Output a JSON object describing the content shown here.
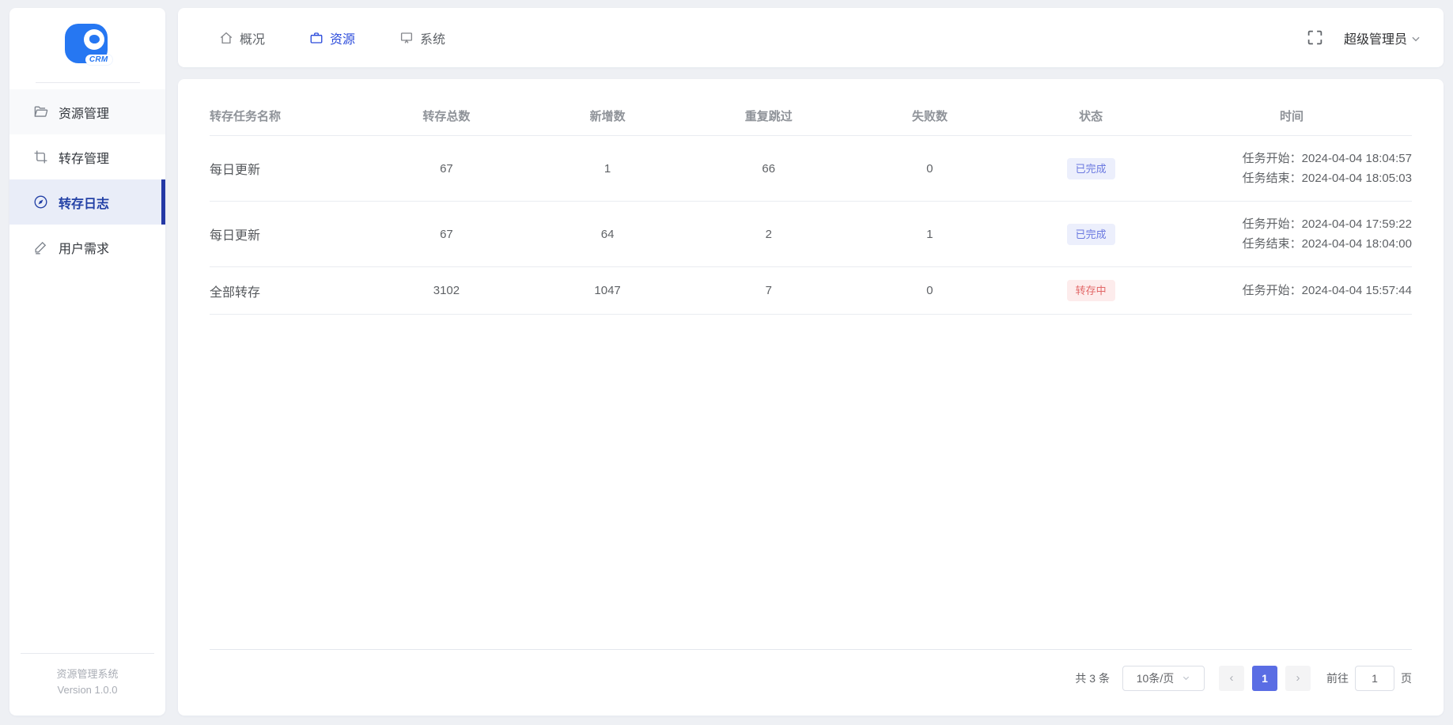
{
  "app": {
    "logo_text": "CRM",
    "footer_title": "资源管理系统",
    "footer_version": "Version 1.0.0"
  },
  "sidebar": {
    "items": [
      {
        "id": "resource-management",
        "label": "资源管理",
        "icon": "folder-icon",
        "active": false,
        "state": "hover"
      },
      {
        "id": "transfer-management",
        "label": "转存管理",
        "icon": "crop-icon",
        "active": false,
        "state": ""
      },
      {
        "id": "transfer-log",
        "label": "转存日志",
        "icon": "compass-icon",
        "active": true,
        "state": ""
      },
      {
        "id": "user-requests",
        "label": "用户需求",
        "icon": "edit-icon",
        "active": false,
        "state": ""
      }
    ]
  },
  "header": {
    "tabs": [
      {
        "id": "overview",
        "label": "概况",
        "icon": "home-icon",
        "active": false
      },
      {
        "id": "resources",
        "label": "资源",
        "icon": "briefcase-icon",
        "active": true
      },
      {
        "id": "system",
        "label": "系统",
        "icon": "monitor-icon",
        "active": false
      }
    ],
    "user_menu": "超级管理员"
  },
  "table": {
    "columns": [
      "转存任务名称",
      "转存总数",
      "新增数",
      "重复跳过",
      "失败数",
      "状态",
      "时间"
    ],
    "rows": [
      {
        "name": "每日更新",
        "total": "67",
        "added": "1",
        "skipped": "66",
        "failed": "0",
        "status": {
          "label": "已完成",
          "type": "done"
        },
        "times": [
          {
            "label": "任务开始：",
            "value": "2024-04-04 18:04:57"
          },
          {
            "label": "任务结束：",
            "value": "2024-04-04 18:05:03"
          }
        ]
      },
      {
        "name": "每日更新",
        "total": "67",
        "added": "64",
        "skipped": "2",
        "failed": "1",
        "status": {
          "label": "已完成",
          "type": "done"
        },
        "times": [
          {
            "label": "任务开始：",
            "value": "2024-04-04 17:59:22"
          },
          {
            "label": "任务结束：",
            "value": "2024-04-04 18:04:00"
          }
        ]
      },
      {
        "name": "全部转存",
        "total": "3102",
        "added": "1047",
        "skipped": "7",
        "failed": "0",
        "status": {
          "label": "转存中",
          "type": "running"
        },
        "times": [
          {
            "label": "任务开始：",
            "value": "2024-04-04 15:57:44"
          }
        ]
      }
    ]
  },
  "pagination": {
    "total_text": "共 3 条",
    "page_size": "10条/页",
    "prev": "‹",
    "next": "›",
    "current_page": "1",
    "goto_label": "前往",
    "goto_value": "1",
    "goto_suffix": "页"
  },
  "colors": {
    "background": "#eef0f4",
    "brand_blue": "#2677f2",
    "nav_active": "#2b4bdb",
    "sidebar_active_text": "#2341a6",
    "sidebar_active_bg": "#e9edf8",
    "sidebar_active_bar": "#2438a5",
    "status_done_text": "#6b79e0",
    "status_done_bg": "#eceffc",
    "status_running_text": "#e26868",
    "status_running_bg": "#fdecec",
    "page_active_bg": "#5a6de4"
  }
}
